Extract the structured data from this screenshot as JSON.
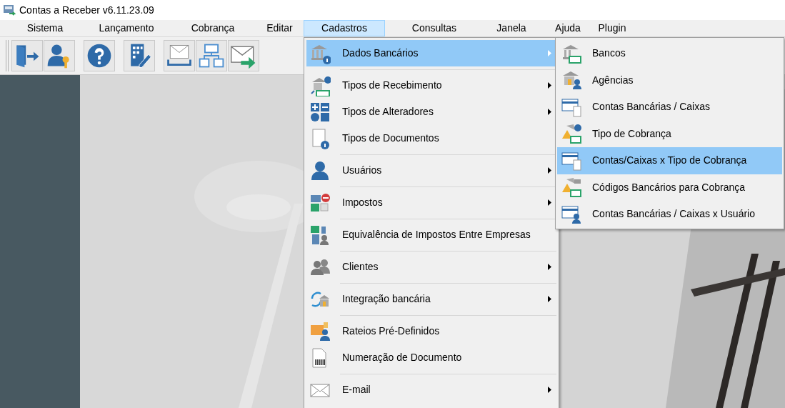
{
  "window": {
    "title": "Contas a Receber v6.11.23.09"
  },
  "menubar": [
    {
      "label": "Sistema",
      "selected": false
    },
    {
      "label": "Lançamento",
      "selected": false
    },
    {
      "label": "Cobrança",
      "selected": false
    },
    {
      "label": "Editar",
      "selected": false
    },
    {
      "label": "Cadastros",
      "selected": true
    },
    {
      "label": "Consultas",
      "selected": false
    },
    {
      "label": "Janela",
      "selected": false
    },
    {
      "label": "Ajuda",
      "selected": false
    },
    {
      "label": "Plugin",
      "selected": false
    }
  ],
  "menu": {
    "groups": [
      [
        {
          "label": "Dados Bancários",
          "submenu": true,
          "selected": true
        }
      ],
      [
        {
          "label": "Tipos de Recebimento",
          "submenu": true,
          "selected": false
        },
        {
          "label": "Tipos de Alteradores",
          "submenu": true,
          "selected": false
        },
        {
          "label": "Tipos de Documentos",
          "submenu": false,
          "selected": false
        }
      ],
      [
        {
          "label": "Usuários",
          "submenu": true,
          "selected": false
        }
      ],
      [
        {
          "label": "Impostos",
          "submenu": true,
          "selected": false
        }
      ],
      [
        {
          "label": "Equivalência de Impostos Entre Empresas",
          "submenu": false,
          "selected": false
        }
      ],
      [
        {
          "label": "Clientes",
          "submenu": true,
          "selected": false
        }
      ],
      [
        {
          "label": "Integração bancária",
          "submenu": true,
          "selected": false
        }
      ],
      [
        {
          "label": "Rateios Pré-Definidos",
          "submenu": false,
          "selected": false
        },
        {
          "label": "Numeração de Documento",
          "submenu": false,
          "selected": false
        }
      ],
      [
        {
          "label": "E-mail",
          "submenu": true,
          "selected": false
        }
      ]
    ]
  },
  "submenu": {
    "items": [
      {
        "label": "Bancos",
        "selected": false
      },
      {
        "label": "Agências",
        "selected": false
      },
      {
        "label": "Contas Bancárias / Caixas",
        "selected": false
      },
      {
        "label": "Tipo de Cobrança",
        "selected": false
      },
      {
        "label": "Contas/Caixas x Tipo de Cobrança",
        "selected": true
      },
      {
        "label": "Códigos Bancários para Cobrança",
        "selected": false
      },
      {
        "label": "Contas Bancárias / Caixas x Usuário",
        "selected": false
      }
    ]
  }
}
